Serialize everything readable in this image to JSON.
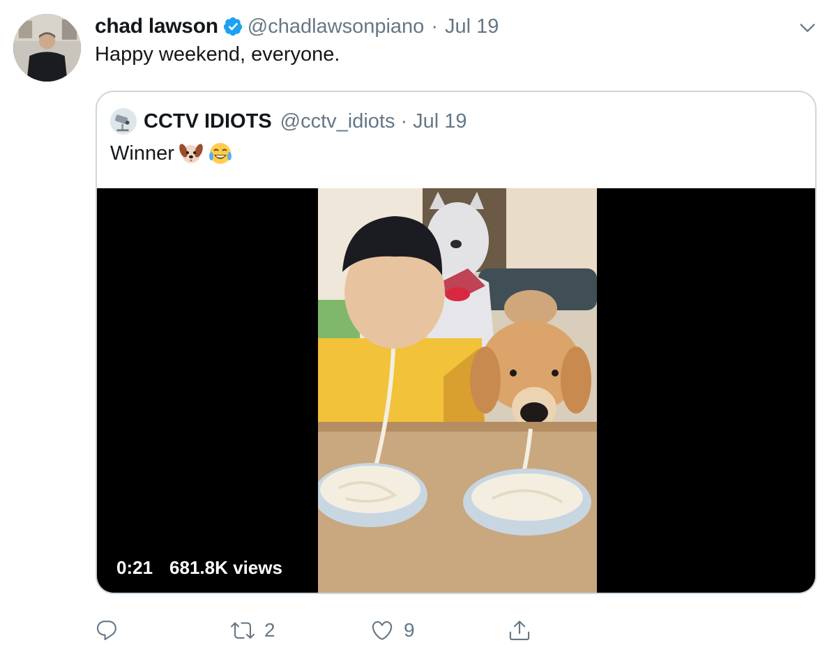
{
  "tweet": {
    "display_name": "chad lawson",
    "handle": "@chadlawsonpiano",
    "separator": "·",
    "date": "Jul 19",
    "text": "Happy weekend, everyone.",
    "verified": true
  },
  "quoted_tweet": {
    "display_name": "CCTV IDIOTS",
    "handle": "@cctv_idiots",
    "separator": "·",
    "date": "Jul 19",
    "text": "Winner",
    "emojis": [
      "dog-face-emoji",
      "tears-of-joy-emoji"
    ]
  },
  "video": {
    "duration": "0:21",
    "views": "681.8K views"
  },
  "actions": {
    "reply_count": "",
    "retweet_count": "2",
    "like_count": "9"
  },
  "colors": {
    "text_primary": "#14171a",
    "text_secondary": "#657786",
    "verified_blue": "#1da1f2",
    "border": "#ccd6dd"
  }
}
